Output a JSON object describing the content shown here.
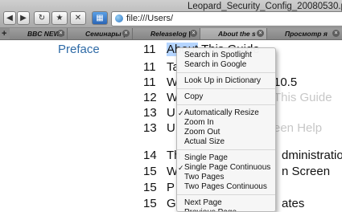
{
  "window": {
    "title": "Leopard_Security_Config_20080530.pdf (application/pdf"
  },
  "toolbar": {
    "back": "◀",
    "forward": "▶",
    "reload": "↻",
    "bookmark": "★",
    "url": "file:///Users/"
  },
  "tabs": [
    {
      "label": "BBC NEWS |"
    },
    {
      "label": "Семинары |"
    },
    {
      "label": "Releaselog |"
    },
    {
      "label": "About the s"
    },
    {
      "label": "Просмотр я"
    }
  ],
  "document": {
    "heading": "Preface",
    "rows": [
      {
        "num": "11",
        "text": "About This Guide"
      },
      {
        "num": "11",
        "text": "Ta"
      },
      {
        "num": "11",
        "text": "W",
        "tail": "10.5"
      },
      {
        "num": "12",
        "text": "W",
        "tail_faint": "This Guide"
      },
      {
        "num": "13",
        "text": "U"
      },
      {
        "num": "13",
        "text": "U",
        "tail_faint": "een Help"
      },
      {
        "num": "14",
        "text": "Th",
        "tail": "dministration"
      },
      {
        "num": "15",
        "text": "W",
        "tail": "n Screen"
      },
      {
        "num": "15",
        "text": "P"
      },
      {
        "num": "15",
        "text": "G",
        "tail": "ates"
      }
    ]
  },
  "menu": {
    "groups": [
      [
        "Search in Spotlight",
        "Search in Google"
      ],
      [
        "Look Up in Dictionary"
      ],
      [
        "Copy"
      ],
      [
        "Automatically Resize",
        "Zoom In",
        "Zoom Out",
        "Actual Size"
      ],
      [
        "Single Page",
        "Single Page Continuous",
        "Two Pages",
        "Two Pages Continuous"
      ],
      [
        "Next Page",
        "Previous Page"
      ]
    ],
    "checked": [
      "Automatically Resize",
      "Single Page Continuous"
    ],
    "check_glyph": "✓"
  }
}
